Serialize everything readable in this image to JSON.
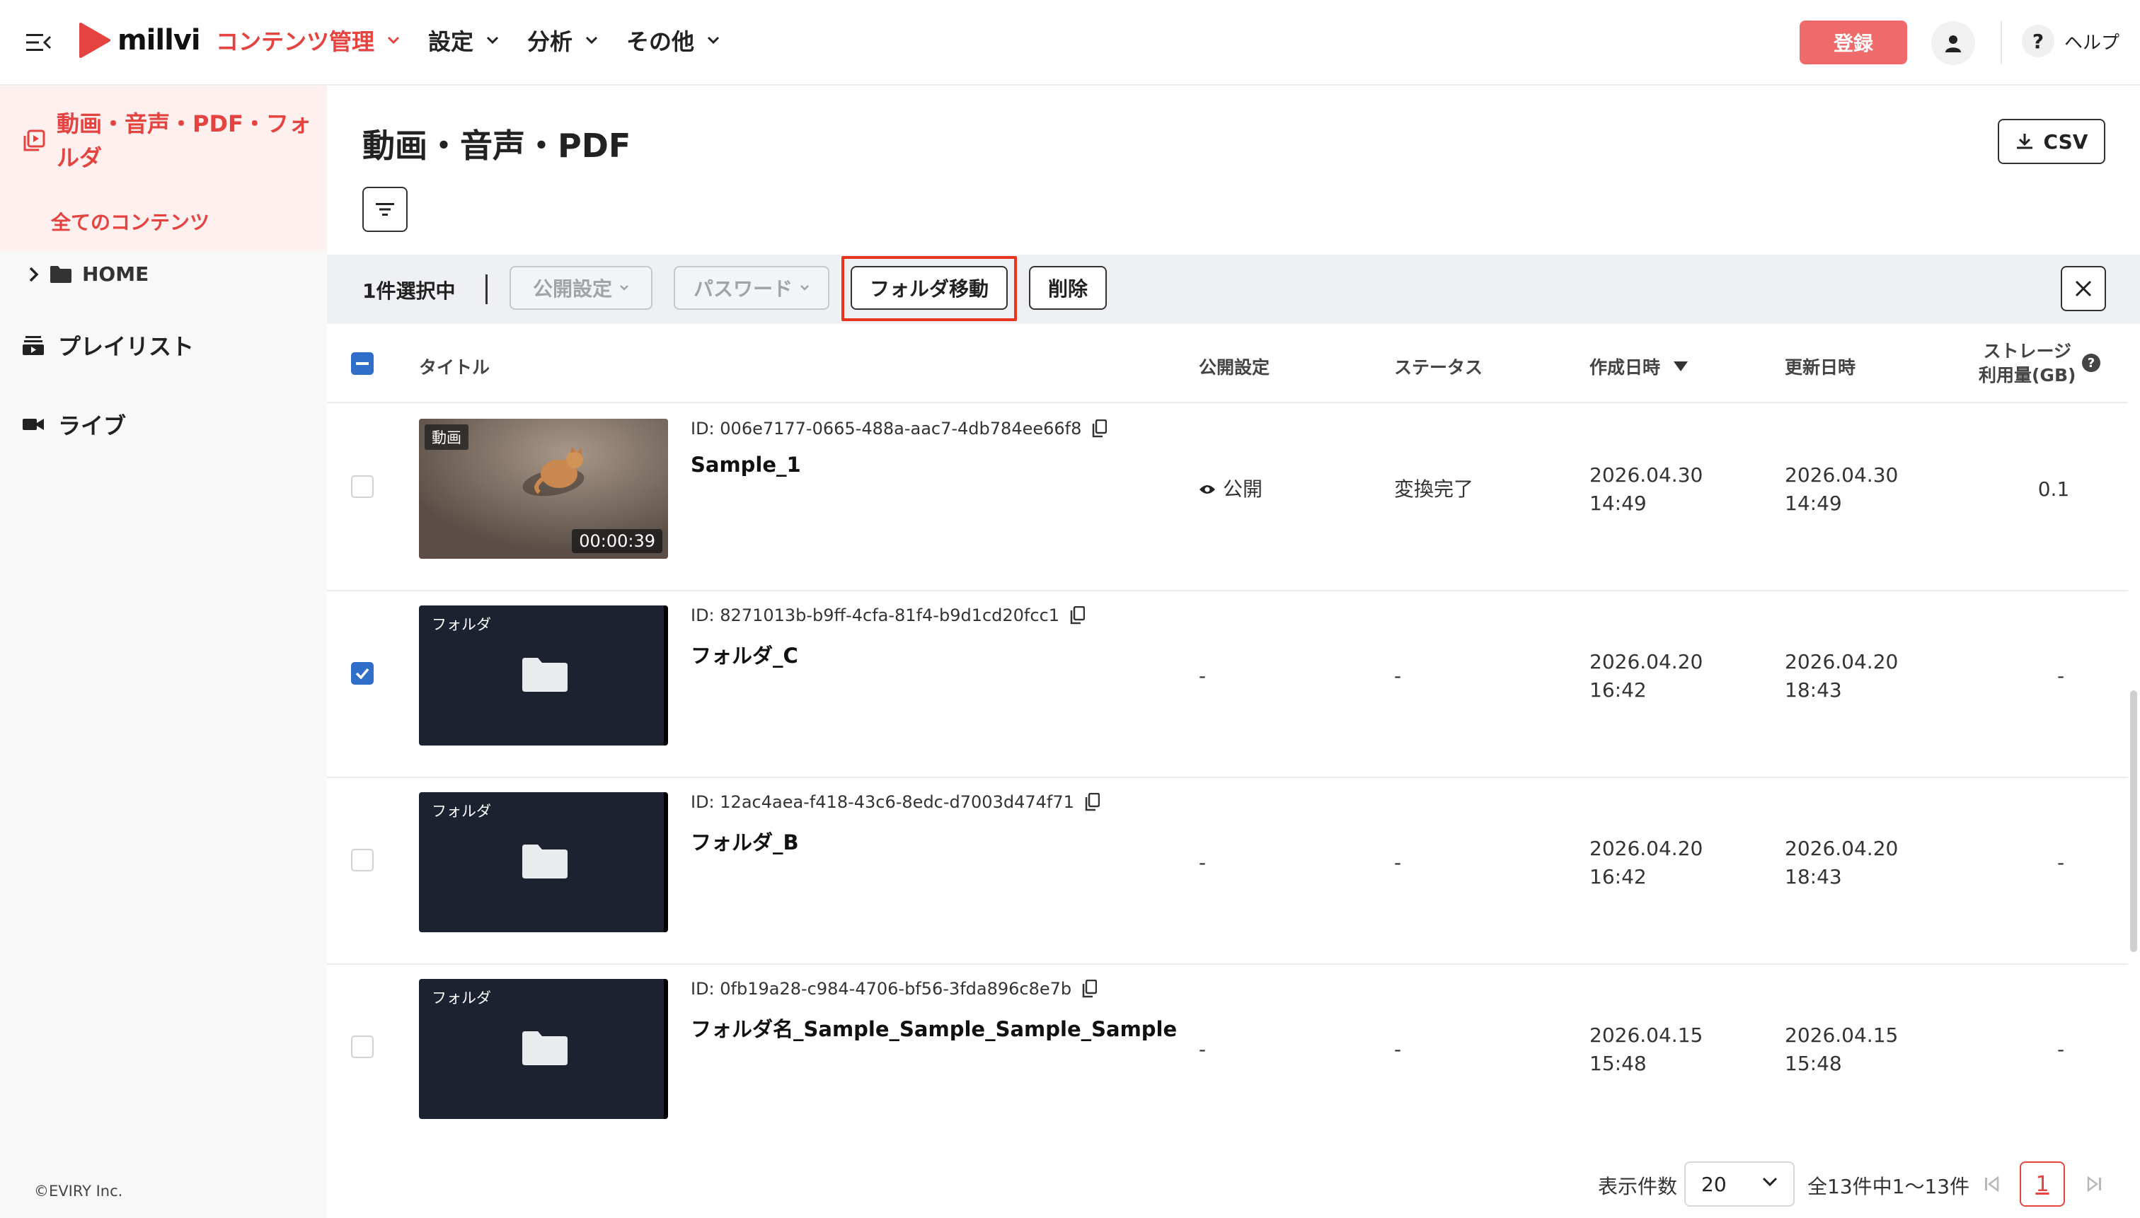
{
  "header": {
    "logo_text": "millvi",
    "nav": [
      {
        "label": "コンテンツ管理",
        "active": true
      },
      {
        "label": "設定",
        "active": false
      },
      {
        "label": "分析",
        "active": false
      },
      {
        "label": "その他",
        "active": false
      }
    ],
    "register_label": "登録",
    "help_mark": "?",
    "help_label": "ヘルプ",
    "accent_color": "#e4433f",
    "register_color": "#ef6a6a"
  },
  "sidebar": {
    "active_title": "動画・音声・PDF・フォルダ",
    "active_sub": "全てのコンテンツ",
    "home_label": "HOME",
    "items": [
      {
        "label": "プレイリスト",
        "icon": "playlist-icon"
      },
      {
        "label": "ライブ",
        "icon": "camera-icon"
      }
    ],
    "copyright": "©EVIRY Inc."
  },
  "main": {
    "title": "動画・音声・PDF",
    "csv_label": "CSV"
  },
  "action_bar": {
    "selected_text": "1件選択中",
    "publish_label": "公開設定",
    "password_label": "パスワード",
    "move_folder_label": "フォルダ移動",
    "delete_label": "削除",
    "highlight_color": "#e8331e"
  },
  "table": {
    "headers": {
      "title": "タイトル",
      "publish": "公開設定",
      "status": "ステータス",
      "created": "作成日時",
      "updated": "更新日時",
      "storage_line1": "ストレージ",
      "storage_line2": "利用量(GB)"
    },
    "rows": [
      {
        "type": "video",
        "thumb_tag": "動画",
        "duration": "00:00:39",
        "id": "ID: 006e7177-0665-488a-aac7-4db784ee66f8",
        "title": "Sample_1",
        "publish": "公開",
        "status": "変換完了",
        "created_date": "2026.04.30",
        "created_time": "14:49",
        "updated_date": "2026.04.30",
        "updated_time": "14:49",
        "storage": "0.1",
        "checked": false
      },
      {
        "type": "folder",
        "thumb_tag": "フォルダ",
        "id": "ID: 8271013b-b9ff-4cfa-81f4-b9d1cd20fcc1",
        "title": "フォルダ_C",
        "publish": "-",
        "status": "-",
        "created_date": "2026.04.20",
        "created_time": "16:42",
        "updated_date": "2026.04.20",
        "updated_time": "18:43",
        "storage": "-",
        "checked": true
      },
      {
        "type": "folder",
        "thumb_tag": "フォルダ",
        "id": "ID: 12ac4aea-f418-43c6-8edc-d7003d474f71",
        "title": "フォルダ_B",
        "publish": "-",
        "status": "-",
        "created_date": "2026.04.20",
        "created_time": "16:42",
        "updated_date": "2026.04.20",
        "updated_time": "18:43",
        "storage": "-",
        "checked": false
      },
      {
        "type": "folder",
        "thumb_tag": "フォルダ",
        "id": "ID: 0fb19a28-c984-4706-bf56-3fda896c8e7b",
        "title": "フォルダ名_Sample_Sample_Sample_Sample...",
        "publish": "-",
        "status": "-",
        "created_date": "2026.04.15",
        "created_time": "15:48",
        "updated_date": "2026.04.15",
        "updated_time": "15:48",
        "storage": "-",
        "checked": false
      }
    ]
  },
  "pagination": {
    "per_page_label": "表示件数",
    "per_page_value": "20",
    "range_text": "全13件中1〜13件",
    "current_page": "1"
  }
}
